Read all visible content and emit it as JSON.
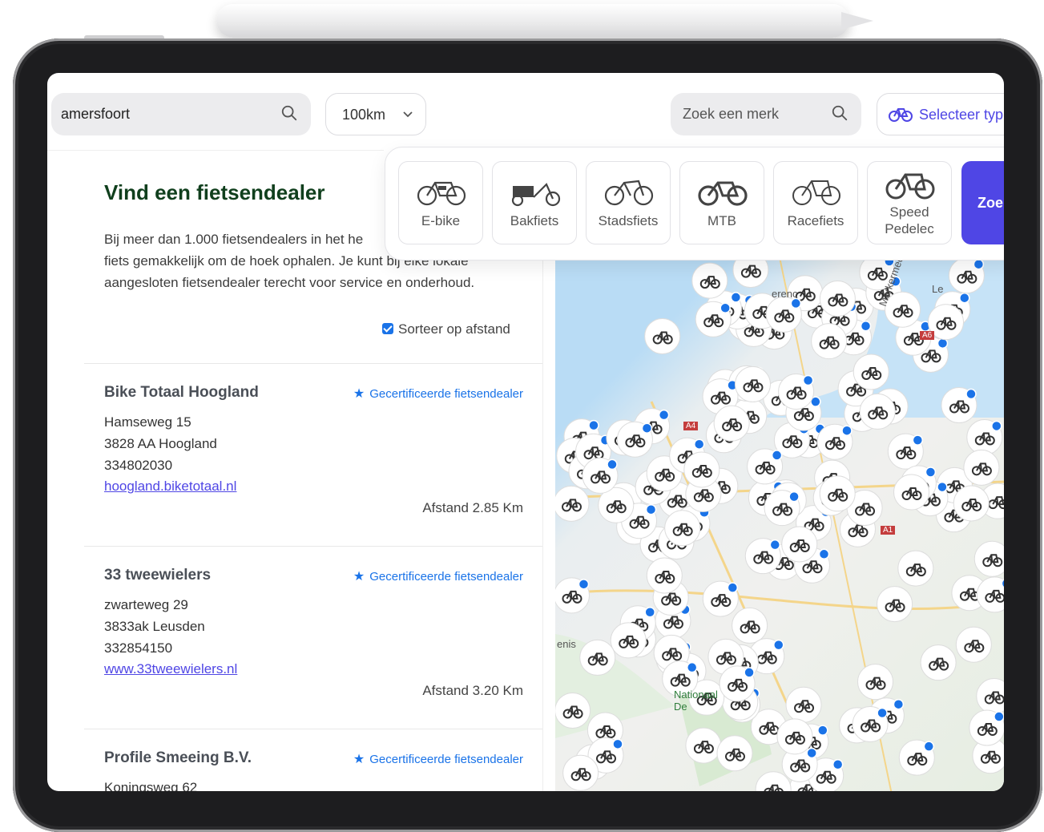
{
  "search": {
    "location_value": "amersfoort",
    "radius": "100km",
    "brand_placeholder": "Zoek een merk",
    "type_button": "Selecteer typ"
  },
  "types": [
    {
      "label": "E-bike"
    },
    {
      "label": "Bakfiets"
    },
    {
      "label": "Stadsfiets"
    },
    {
      "label": "MTB"
    },
    {
      "label": "Racefiets"
    },
    {
      "label": "Speed Pedelec",
      "line1": "Speed",
      "line2": "Pedelec"
    }
  ],
  "search_button": "Zoe",
  "list": {
    "title": "Vind een fietsendealer",
    "intro_lines": [
      "Bij meer dan 1.000 fietsendealers in het he",
      "fiets gemakkelijk om de hoek ophalen. Je kunt bij elke lokale",
      "aangesloten fietsendealer terecht voor service en onderhoud."
    ],
    "sort_label": "Sorteer op afstand",
    "sort_checked": true,
    "dealers": [
      {
        "name": "Bike Totaal Hoogland",
        "badge": "Gecertificeerde fietsendealer",
        "street": "Hamseweg 15",
        "city": "3828 AA Hoogland",
        "phone": "334802030",
        "website": "hoogland.biketotaal.nl",
        "distance": "Afstand 2.85 Km"
      },
      {
        "name": "33 tweewielers",
        "badge": "Gecertificeerde fietsendealer",
        "street": "zwarteweg 29",
        "city": "3833ak Leusden",
        "phone": "332854150",
        "website": "www.33tweewielers.nl",
        "distance": "Afstand 3.20 Km"
      },
      {
        "name": "Profile Smeeing B.V.",
        "badge": "Gecertificeerde fietsendealer",
        "street": "Koningsweg 62"
      }
    ]
  },
  "map": {
    "labels": [
      "Markermeer",
      "Le",
      "A6",
      "A4",
      "A1",
      "Nationaal De",
      "enis",
      "erenc"
    ],
    "marker_icon": "bike-marker-icon",
    "certified_badge_icon": "star-badge-icon",
    "water_color": "#b9dcf5",
    "accent_color": "#1a73e8"
  },
  "colors": {
    "brand": "#4f46e5",
    "title": "#103f1d",
    "link": "#4f46e5",
    "certified": "#1a73e8"
  }
}
